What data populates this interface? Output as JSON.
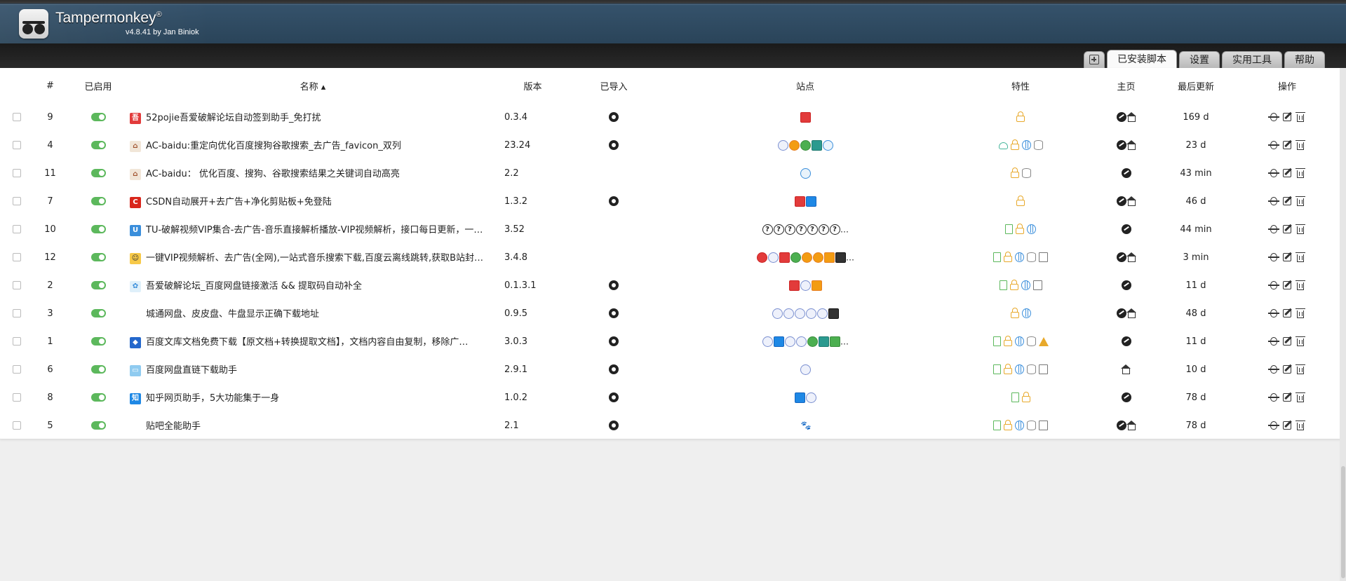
{
  "app": {
    "title": "Tampermonkey",
    "reg": "®",
    "subtitle": "v4.8.41 by Jan Biniok"
  },
  "tabs": [
    {
      "label": "",
      "icon": "new-script-icon"
    },
    {
      "label": "已安装脚本",
      "active": true
    },
    {
      "label": "设置"
    },
    {
      "label": "实用工具"
    },
    {
      "label": "帮助"
    }
  ],
  "columns": {
    "num": "#",
    "enabled": "已启用",
    "name": "名称 ▴",
    "version": "版本",
    "imported": "已导入",
    "sites": "站点",
    "features": "特性",
    "homepage": "主页",
    "updated": "最后更新",
    "actions": "操作"
  },
  "rows": [
    {
      "num": "9",
      "name": "52pojie吾爱破解论坛自动签到助手_免打扰",
      "version": "0.3.4",
      "updated": "169 d"
    },
    {
      "num": "4",
      "name": "AC-baidu:重定向优化百度搜狗谷歌搜索_去广告_favicon_双列",
      "version": "23.24",
      "updated": "23 d"
    },
    {
      "num": "11",
      "name": "AC-baidu： 优化百度、搜狗、谷歌搜索结果之关键词自动高亮",
      "version": "2.2",
      "updated": "43 min"
    },
    {
      "num": "7",
      "name": "CSDN自动展开+去广告+净化剪贴板+免登陆",
      "version": "1.3.2",
      "updated": "46 d"
    },
    {
      "num": "10",
      "name": "TU-破解视频VIP集合-去广告-音乐直接解析播放-VIP视频解析，接口每日更新，一…",
      "version": "3.52",
      "updated": "44 min"
    },
    {
      "num": "12",
      "name": "一键VIP视频解析、去广告(全网),一站式音乐搜索下载,百度云离线跳转,获取B站封…",
      "version": "3.4.8",
      "updated": "3 min"
    },
    {
      "num": "2",
      "name": "吾爱破解论坛_百度网盘链接激活 && 提取码自动补全",
      "version": "0.1.3.1",
      "updated": "11 d"
    },
    {
      "num": "3",
      "name": "城通网盘、皮皮盘、牛盘显示正确下载地址",
      "version": "0.9.5",
      "updated": "48 d"
    },
    {
      "num": "1",
      "name": "百度文库文档免费下载【原文档+转换提取文档】，文档内容自由复制，移除广…",
      "version": "3.0.3",
      "updated": "11 d"
    },
    {
      "num": "6",
      "name": "百度网盘直链下载助手",
      "version": "2.9.1",
      "updated": "10 d"
    },
    {
      "num": "8",
      "name": "知乎网页助手，5大功能集于一身",
      "version": "1.0.2",
      "updated": "78 d"
    },
    {
      "num": "5",
      "name": "贴吧全能助手",
      "version": "2.1",
      "updated": "78 d"
    }
  ],
  "sites_overflow": "…",
  "colors": {
    "header": "#2c475d",
    "toggle_on": "#5cb85c",
    "lock": "#e8a92b",
    "globe": "#3a8edb"
  }
}
